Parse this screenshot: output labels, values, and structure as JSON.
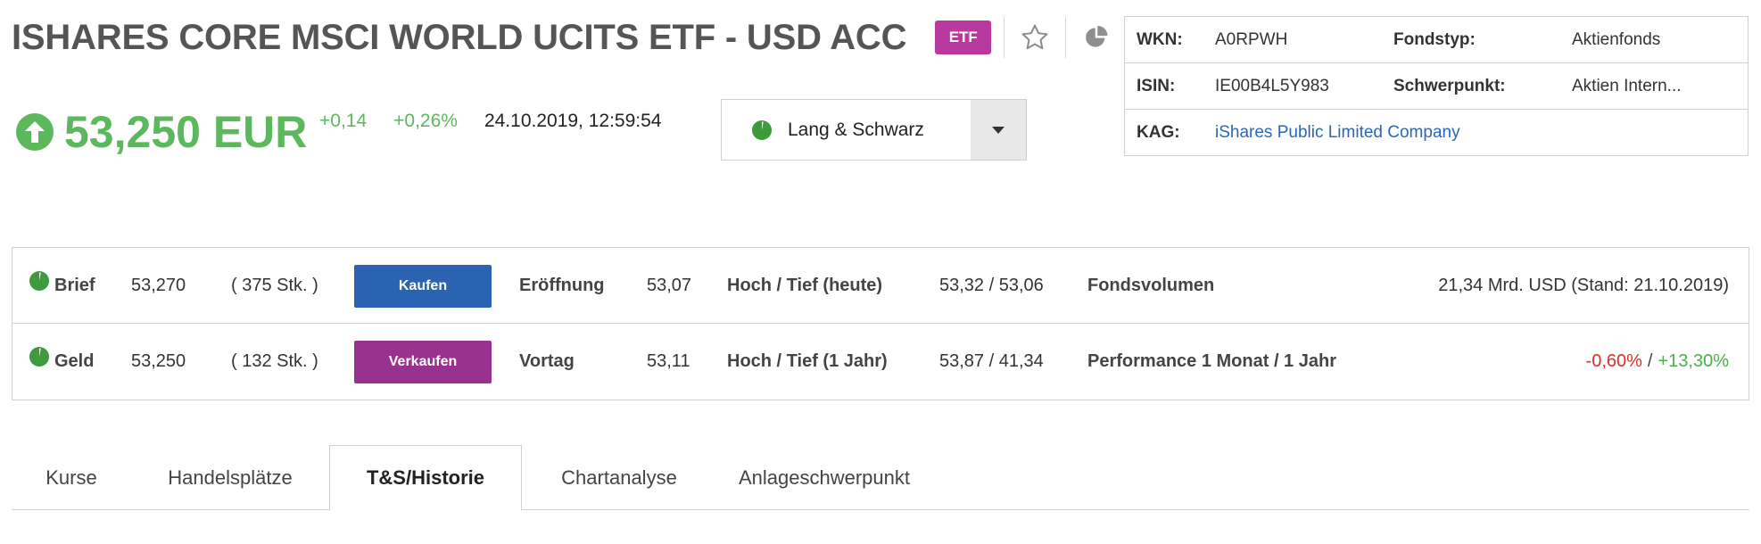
{
  "header": {
    "title": "ISHARES CORE MSCI WORLD UCITS ETF - USD ACC",
    "badge": "ETF",
    "price": "53,250 EUR",
    "change_abs": "+0,14",
    "change_pct": "+0,26%",
    "timestamp": "24.10.2019, 12:59:54",
    "exchange": "Lang & Schwarz",
    "icons": {
      "favorite": "star-icon",
      "portfolio": "pie-chart-icon",
      "trend": "arrow-up-circle-icon",
      "status": "pie-status-icon",
      "dropdown": "caret-down-icon"
    }
  },
  "info": {
    "wkn_label": "WKN:",
    "wkn_value": "A0RPWH",
    "fondstyp_label": "Fondstyp:",
    "fondstyp_value": "Aktienfonds",
    "isin_label": "ISIN:",
    "isin_value": "IE00B4L5Y983",
    "schwerpunkt_label": "Schwerpunkt:",
    "schwerpunkt_value": "Aktien Intern...",
    "kag_label": "KAG:",
    "kag_value": "iShares Public Limited Company"
  },
  "quote": {
    "brief": {
      "label": "Brief",
      "price": "53,270",
      "qty": "( 375 Stk. )",
      "button": "Kaufen",
      "k1": "Eröffnung",
      "v1": "53,07",
      "k2": "Hoch / Tief (heute)",
      "v2": "53,32 / 53,06",
      "k3": "Fondsvolumen",
      "v3": "21,34 Mrd. USD (Stand: 21.10.2019)"
    },
    "geld": {
      "label": "Geld",
      "price": "53,250",
      "qty": "( 132 Stk. )",
      "button": "Verkaufen",
      "k1": "Vortag",
      "v1": "53,11",
      "k2": "Hoch / Tief (1 Jahr)",
      "v2": "53,87 / 41,34",
      "k3": "Performance 1 Monat / 1 Jahr",
      "perf_month": "-0,60%",
      "perf_sep": "/",
      "perf_year": "+13,30%"
    }
  },
  "tabs": [
    {
      "label": "Kurse",
      "active": false
    },
    {
      "label": "Handelsplätze",
      "active": false
    },
    {
      "label": "T&S/Historie",
      "active": true
    },
    {
      "label": "Chartanalyse",
      "active": false
    },
    {
      "label": "Anlageschwerpunkt",
      "active": false
    }
  ],
  "colors": {
    "up": "#5cb85c",
    "down": "#d9302c",
    "badge": "#b93a9e",
    "buy": "#2a63b1",
    "sell": "#99318f",
    "link": "#2a67b8"
  }
}
